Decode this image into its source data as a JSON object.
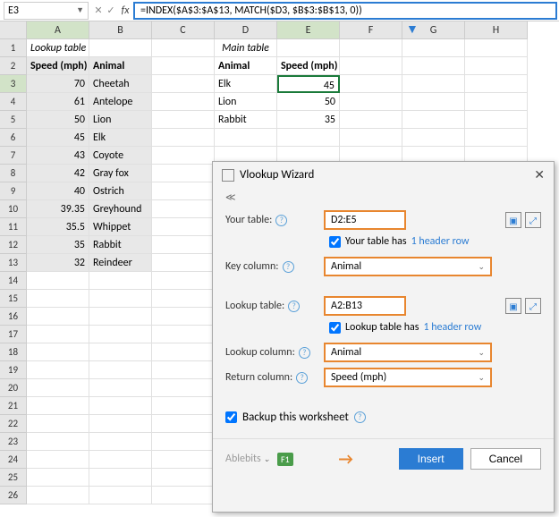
{
  "namebox": "E3",
  "formula": "=INDEX($A$3:$A$13, MATCH($D3, $B$3:$B$13, 0))",
  "cols": [
    "A",
    "B",
    "C",
    "D",
    "E",
    "F",
    "G",
    "H"
  ],
  "title_lookup": "Lookup table",
  "title_main": "Main table",
  "hdr_speed": "Speed (mph)",
  "hdr_animal": "Animal",
  "lookup": [
    {
      "speed": "70",
      "animal": "Cheetah"
    },
    {
      "speed": "61",
      "animal": "Antelope"
    },
    {
      "speed": "50",
      "animal": "Lion"
    },
    {
      "speed": "45",
      "animal": "Elk"
    },
    {
      "speed": "43",
      "animal": "Coyote"
    },
    {
      "speed": "42",
      "animal": "Gray fox"
    },
    {
      "speed": "40",
      "animal": "Ostrich"
    },
    {
      "speed": "39.35",
      "animal": "Greyhound"
    },
    {
      "speed": "35.5",
      "animal": "Whippet"
    },
    {
      "speed": "35",
      "animal": "Rabbit"
    },
    {
      "speed": "32",
      "animal": "Reindeer"
    }
  ],
  "main": [
    {
      "animal": "Elk",
      "speed": "45"
    },
    {
      "animal": "Lion",
      "speed": "50"
    },
    {
      "animal": "Rabbit",
      "speed": "35"
    }
  ],
  "dialog": {
    "title": "Vlookup Wizard",
    "your_table_lbl": "Your table:",
    "your_table_val": "D2:E5",
    "your_table_chk": "Your table has",
    "one_header": "1 header row",
    "key_col_lbl": "Key column:",
    "key_col_val": "Animal",
    "lookup_table_lbl": "Lookup table:",
    "lookup_table_val": "A2:B13",
    "lookup_table_chk": "Lookup table has",
    "lookup_col_lbl": "Lookup column:",
    "lookup_col_val": "Animal",
    "return_col_lbl": "Return column:",
    "return_col_val": "Speed (mph)",
    "backup": "Backup this worksheet",
    "brand": "Ablebits",
    "f1": "F1",
    "insert": "Insert",
    "cancel": "Cancel"
  }
}
